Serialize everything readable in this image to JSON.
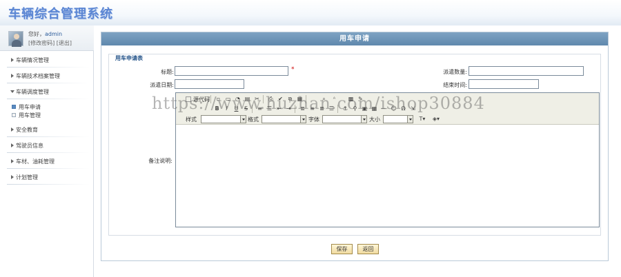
{
  "app": {
    "title": "车辆综合管理系统"
  },
  "user": {
    "greeting_prefix": "您好，",
    "name": "admin",
    "edit_password": "[修改密码]",
    "logout": "[退出]"
  },
  "sidebar": {
    "items": [
      {
        "label": "车辆情况管理"
      },
      {
        "label": "车辆技术档案管理"
      },
      {
        "label": "车辆调度管理"
      },
      {
        "label": "安全教育"
      },
      {
        "label": "驾驶员信息"
      },
      {
        "label": "车材、油耗管理"
      },
      {
        "label": "计划管理"
      }
    ],
    "subitems": [
      {
        "label": "用车申请"
      },
      {
        "label": "用车管理"
      }
    ]
  },
  "page": {
    "title": "用车申请"
  },
  "form": {
    "legend": "用车申请表",
    "title_label": "标题:",
    "required_mark": "*",
    "quantity_label": "派遣数量:",
    "dispatch_date_label": "派遣日期:",
    "end_time_label": "结束时间:",
    "remarks_label": "备注说明:",
    "title_value": "",
    "quantity_value": "",
    "dispatch_date_value": "",
    "end_time_value": ""
  },
  "editor": {
    "source_label": "源代码",
    "style_label": "样式",
    "format_label": "格式",
    "font_label": "字体",
    "size_label": "大小",
    "content": ""
  },
  "buttons": {
    "save": "保存",
    "back": "返回"
  },
  "watermark": "https://www.huzhan.com/ishop30884",
  "colors": {
    "title_bar": "#6f96b9",
    "logo": "#5b86d4",
    "required": "#cc0000"
  }
}
